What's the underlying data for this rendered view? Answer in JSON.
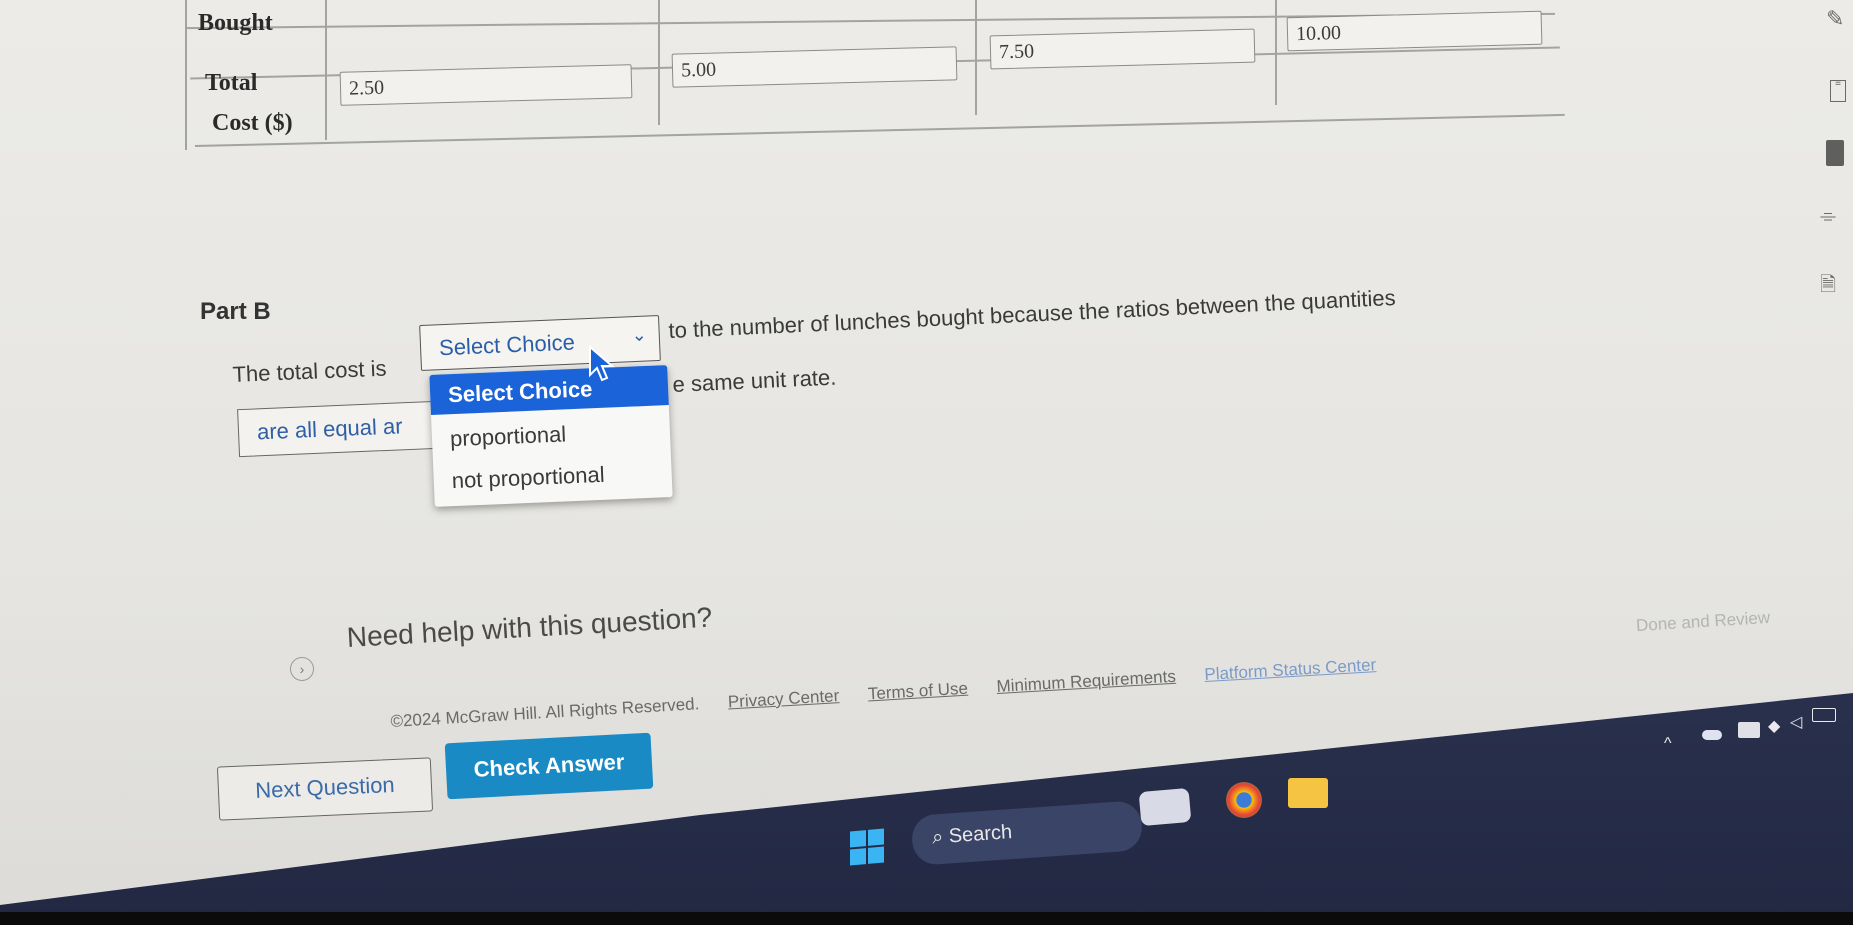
{
  "table": {
    "row1_header": "Bought",
    "row2_header_line1": "Total",
    "row2_header_line2": "Cost ($)",
    "total_cost_values": [
      "2.50",
      "5.00",
      "7.50",
      "10.00"
    ]
  },
  "tools": {
    "icons": [
      "pencil-icon",
      "notes-icon",
      "calculator-icon",
      "highlighter-icon",
      "text-to-speech-icon"
    ]
  },
  "part_b": {
    "heading": "Part B",
    "sentence_before_dropdown": "The total cost is",
    "sentence_after_dropdown": "to the number of lunches bought because the ratios between the quantities",
    "second_box_text": "are all equal ar",
    "second_line_tail": "e same unit rate.",
    "dropdown": {
      "current_value": "Select Choice",
      "options": [
        "Select Choice",
        "proportional",
        "not proportional"
      ],
      "highlighted_option": "Select Choice"
    }
  },
  "help": {
    "text": "Need help with this question?",
    "done_review": "Done and Review"
  },
  "buttons": {
    "next_question": "Next Question",
    "check_answer": "Check Answer"
  },
  "footer": {
    "copyright": "©2024 McGraw Hill. All Rights Reserved.",
    "links": [
      "Privacy Center",
      "Terms of Use",
      "Minimum Requirements",
      "Platform Status Center"
    ]
  },
  "taskbar": {
    "search_label": "Search",
    "tray_icons": [
      "chevron-up-icon",
      "onedrive-icon",
      "keyboard-icon",
      "wifi-icon",
      "volume-icon",
      "battery-icon"
    ]
  }
}
